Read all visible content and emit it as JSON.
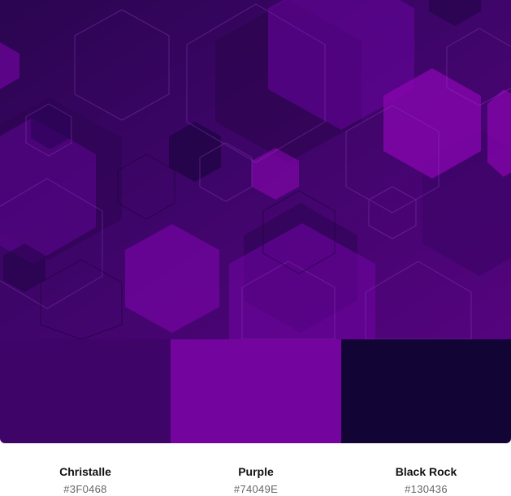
{
  "colors": {
    "background_dark": "#2b0550",
    "accent": "#74049E"
  },
  "palette": [
    {
      "name": "Christalle",
      "hex": "#3F0468",
      "color": "#3F0468"
    },
    {
      "name": "Purple",
      "hex": "#74049E",
      "color": "#74049E"
    },
    {
      "name": "Black Rock",
      "hex": "#130436",
      "color": "#130436"
    }
  ]
}
